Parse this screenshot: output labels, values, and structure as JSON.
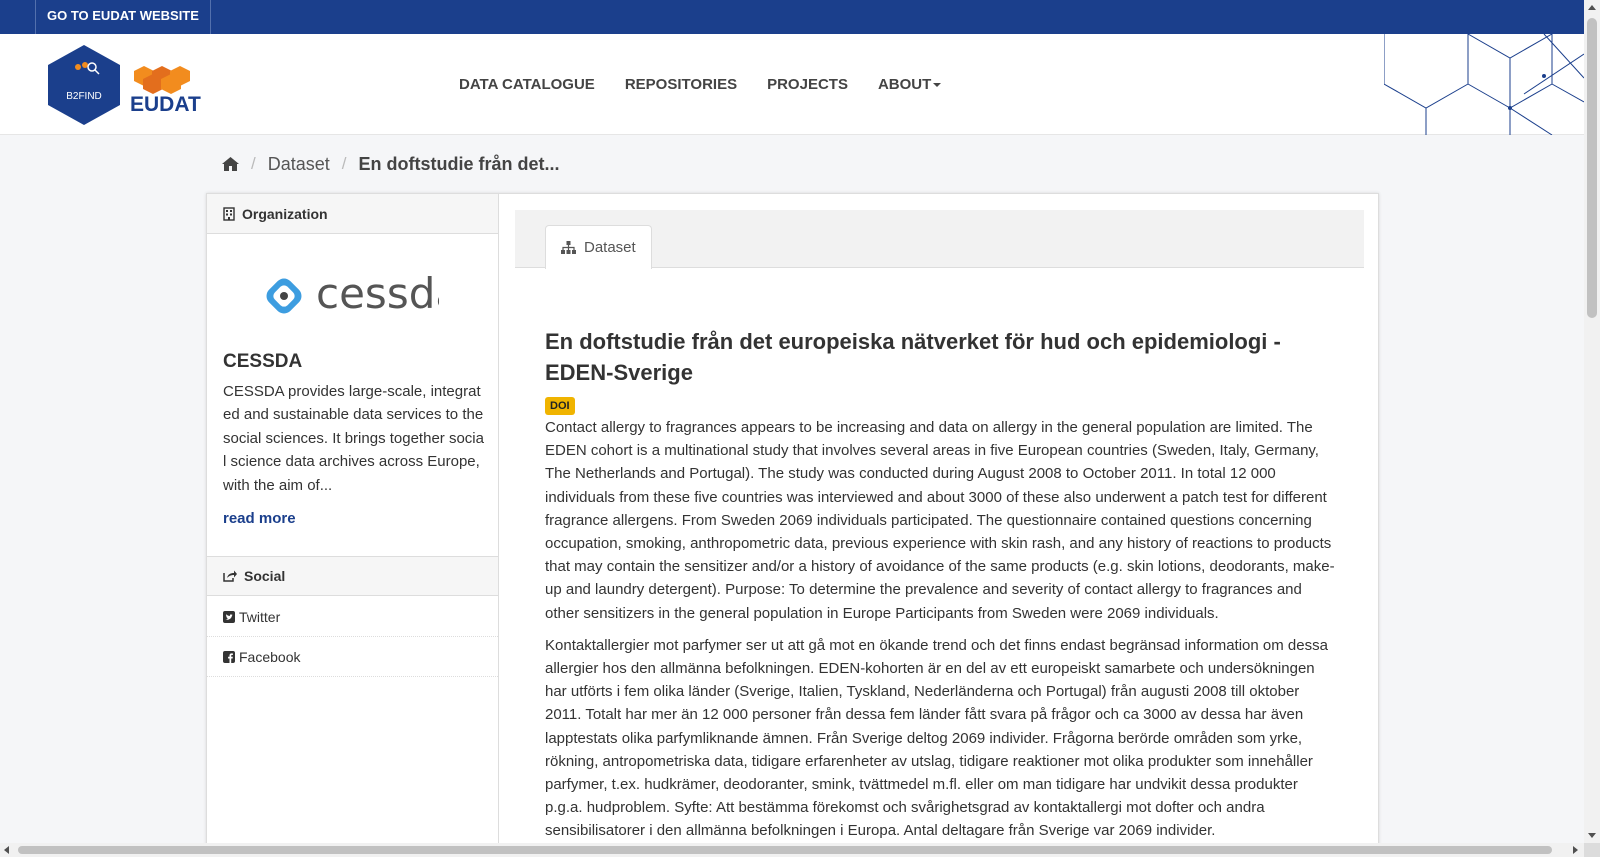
{
  "topbar": {
    "eudat_link": "GO TO EUDAT WEBSITE"
  },
  "header": {
    "logo_b2find_text": "B2FIND",
    "logo_eudat_text": "EUDAT",
    "nav": [
      {
        "label": "DATA CATALOGUE"
      },
      {
        "label": "REPOSITORIES"
      },
      {
        "label": "PROJECTS"
      },
      {
        "label": "ABOUT"
      }
    ]
  },
  "breadcrumb": {
    "items": [
      {
        "label": "Dataset"
      },
      {
        "label": "En doftstudie från det..."
      }
    ]
  },
  "sidebar": {
    "organization_heading": "Organization",
    "org_logo_text": "cessda",
    "org_title": "CESSDA",
    "org_description": "CESSDA provides large-scale, integrated and sustainable data services to the social sciences. It brings together social science data archives across Europe, with the aim of...",
    "read_more": "read more",
    "social_heading": "Social",
    "social_links": [
      {
        "label": "Twitter",
        "icon": "twitter-square-icon"
      },
      {
        "label": "Facebook",
        "icon": "facebook-square-icon"
      }
    ]
  },
  "main": {
    "tab_label": "Dataset",
    "title": "En doftstudie från det europeiska nätverket för hud och epidemiologi - EDEN-Sverige",
    "badge": "DOI",
    "notes": [
      "Contact allergy to fragrances appears to be increasing and data on allergy in the general population are limited. The EDEN cohort is a multinational study that involves several areas in five European countries (Sweden, Italy, Germany, The Netherlands and Portugal). The study was conducted during August 2008 to October 2011. In total 12 000 individuals from these five countries was interviewed and about 3000 of these also underwent a patch test for different fragrance allergens. From Sweden 2069 individuals participated. The questionnaire contained questions concerning occupation, smoking, anthropometric data, previous experience with skin rash, and any history of reactions to products that may contain the sensitizer and/or a history of avoidance of the same products (e.g. skin lotions, deodorants, make-up and laundry detergent). Purpose: To determine the prevalence and severity of contact allergy to fragrances and other sensitizers in the general population in Europe Participants from Sweden were 2069 individuals.",
      "Kontaktallergier mot parfymer ser ut att gå mot en ökande trend och det finns endast begränsad information om dessa allergier hos den allmänna befolkningen. EDEN-kohorten är en del av ett europeiskt samarbete och undersökningen har utförts i fem olika länder (Sverige, Italien, Tyskland, Nederländerna och Portugal) från augusti 2008 till oktober 2011. Totalt har mer än 12 000 personer från dessa fem länder fått svara på frågor och ca 3000 av dessa har även lapptestats olika parfymliknande ämnen. Från Sverige deltog 2069 individer. Frågorna berörde områden som yrke, rökning, antropometriska data, tidigare erfarenheter av utslag, tidigare reaktioner mot olika produkter som innehåller parfymer, t.ex. hudkrämer, deodoranter, smink, tvättmedel m.fl. eller om man tidigare har undvikit dessa produkter p.g.a. hudproblem. Syfte: Att bestämma förekomst och svårighetsgrad av kontaktallergi mot dofter och andra sensibilisatorer i den allmänna befolkningen i Europa. Antal deltagare från Sverige var 2069 individer."
    ]
  },
  "colors": {
    "brand_blue": "#1b3f8c",
    "logo_orange": "#f28c1e",
    "cessda_blue": "#3d9de0",
    "doi_badge": "#f0b400"
  }
}
